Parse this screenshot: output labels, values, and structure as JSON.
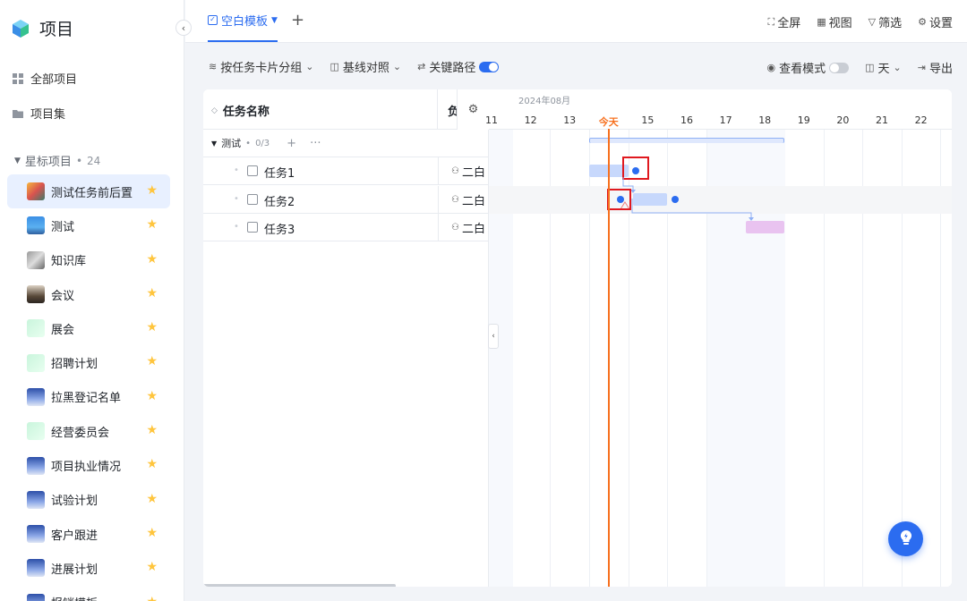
{
  "app": {
    "title": "项目"
  },
  "sidebar": {
    "nav": [
      {
        "label": "全部项目",
        "icon": "grid-icon"
      },
      {
        "label": "项目集",
        "icon": "folder-icon"
      }
    ],
    "section": {
      "label": "星标项目",
      "count": "24"
    },
    "projects": [
      {
        "name": "测试任务前后置",
        "thumb": "linear-gradient(135deg,#f6b73c,#d9534f 50%,#3d7a6b)"
      },
      {
        "name": "测试",
        "thumb": "linear-gradient(180deg,#3b8fe5,#5bb0f0 60%,#2e5f9e)"
      },
      {
        "name": "知识库",
        "thumb": "linear-gradient(135deg,#999,#ddd 50%,#666)"
      },
      {
        "name": "会议",
        "thumb": "linear-gradient(180deg,#dcd2c4,#5a4a3a 60%,#2c2520)"
      },
      {
        "name": "展会",
        "thumb": "linear-gradient(135deg,#c9f5dc,#e8fff0)"
      },
      {
        "name": "招聘计划",
        "thumb": "linear-gradient(135deg,#c9f5dc,#e8fff0)"
      },
      {
        "name": "拉黑登记名单",
        "thumb": "linear-gradient(180deg,#2c4fa8,#8aa6e6 60%,#dfe6f5)"
      },
      {
        "name": "经营委员会",
        "thumb": "linear-gradient(135deg,#c9f5dc,#e8fff0)"
      },
      {
        "name": "项目执业情况",
        "thumb": "linear-gradient(180deg,#2c4fa8,#8aa6e6 60%,#dfe6f5)"
      },
      {
        "name": "试验计划",
        "thumb": "linear-gradient(180deg,#2c4fa8,#8aa6e6 60%,#dfe6f5)"
      },
      {
        "name": "客户跟进",
        "thumb": "linear-gradient(180deg,#2c4fa8,#8aa6e6 60%,#dfe6f5)"
      },
      {
        "name": "进展计划",
        "thumb": "linear-gradient(180deg,#2c4fa8,#8aa6e6 60%,#dfe6f5)"
      },
      {
        "name": "报销模板",
        "thumb": "linear-gradient(180deg,#2c4fa8,#8aa6e6 60%,#dfe6f5)"
      }
    ]
  },
  "topbar": {
    "active_tab": "空白模板",
    "add": "+",
    "actions": [
      {
        "label": "全屏",
        "icon": "fullscreen-icon",
        "glyph": "⛶"
      },
      {
        "label": "视图",
        "icon": "view-icon",
        "glyph": "▦"
      },
      {
        "label": "筛选",
        "icon": "filter-icon",
        "glyph": "▽"
      },
      {
        "label": "设置",
        "icon": "gear-icon",
        "glyph": "⚙"
      }
    ]
  },
  "toolbar": {
    "group_by": "按任务卡片分组",
    "baseline": "基线对照",
    "critical_path": "关键路径",
    "critical_path_on": true,
    "view_mode": "查看模式",
    "view_mode_on": false,
    "time_scale": "天",
    "export": "导出"
  },
  "table": {
    "col_name": "任务名称",
    "col_owner": "负",
    "group": {
      "name": "测试",
      "count": "0/3",
      "add": "+",
      "more": "···"
    },
    "tasks": [
      {
        "name": "任务1",
        "owner": "二白"
      },
      {
        "name": "任务2",
        "owner": "二白"
      },
      {
        "name": "任务3",
        "owner": "二白"
      }
    ]
  },
  "gantt": {
    "month": "2024年08月",
    "days": [
      "11",
      "12",
      "13",
      "今天",
      "15",
      "16",
      "17",
      "18",
      "19",
      "20",
      "21",
      "22"
    ],
    "today_index": 3,
    "colors": {
      "today": "#f7701e",
      "bar": "#c7d8fc",
      "group_bar": "#c7d8fc",
      "task3": "#e9c3f0",
      "accent": "#2b6cf0",
      "highlight": "#e0191f"
    }
  }
}
